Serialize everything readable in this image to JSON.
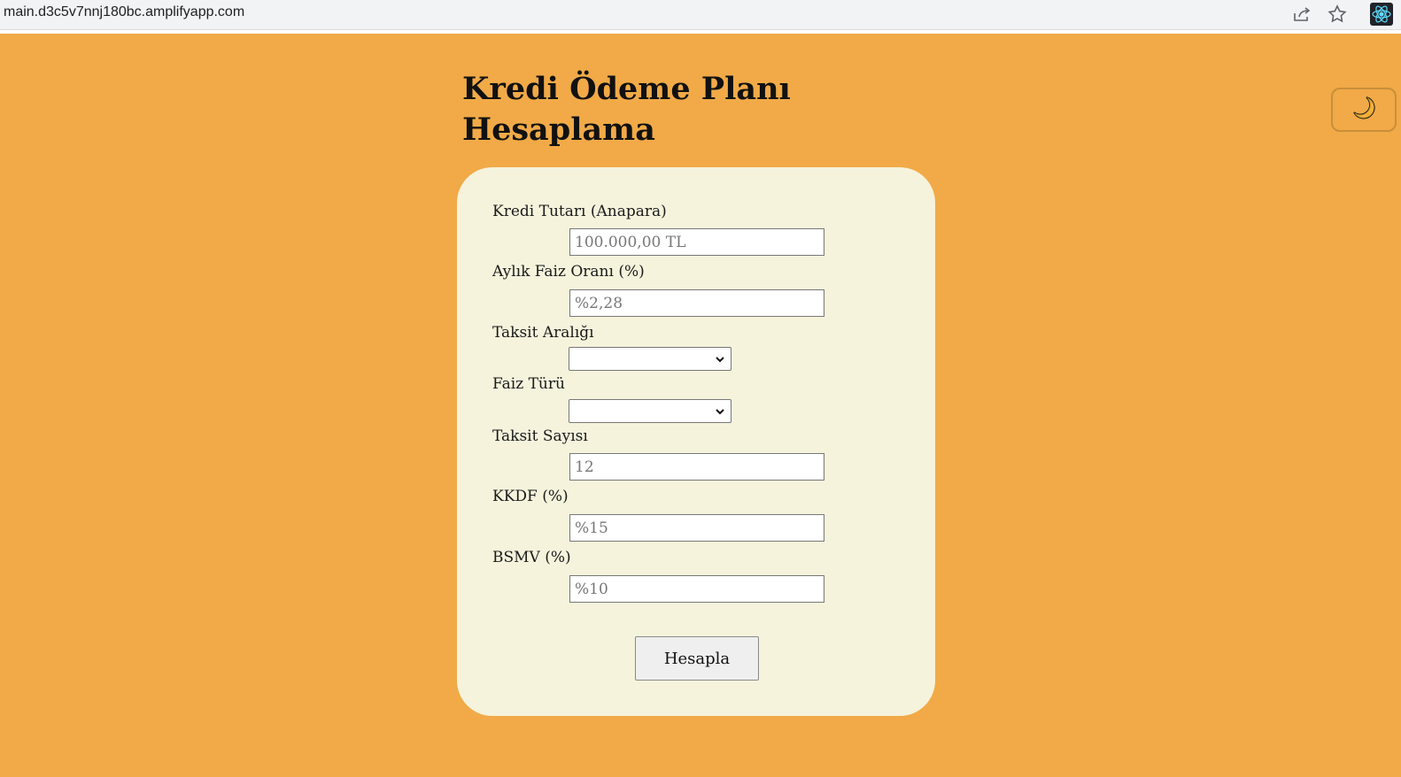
{
  "browser": {
    "url": "main.d3c5v7nnj180bc.amplifyapp.com",
    "icons": [
      "share-icon",
      "star-icon",
      "react-extension-icon"
    ]
  },
  "page": {
    "title": "Kredi Ödeme Planı Hesaplama",
    "theme_toggle_icon": "moon-icon",
    "background_color": "#f1aa47",
    "card_color": "#f5f3dc"
  },
  "form": {
    "loan_amount": {
      "label": "Kredi Tutarı (Anapara)",
      "placeholder": "100.000,00 TL"
    },
    "monthly_rate": {
      "label": "Aylık Faiz Oranı (%)",
      "placeholder": "%2,28"
    },
    "installment_interval": {
      "label": "Taksit Aralığı",
      "value": ""
    },
    "interest_type": {
      "label": "Faiz Türü",
      "value": ""
    },
    "installment_count": {
      "label": "Taksit Sayısı",
      "placeholder": "12"
    },
    "kkdf": {
      "label": "KKDF (%)",
      "placeholder": "%15"
    },
    "bsmv": {
      "label": "BSMV (%)",
      "placeholder": "%10"
    },
    "submit_label": "Hesapla"
  }
}
